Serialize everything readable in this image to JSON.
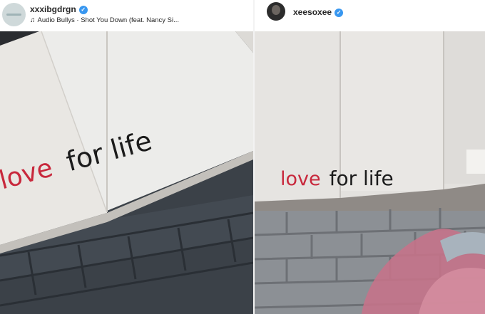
{
  "posts": [
    {
      "username": "xxxibgdrgn",
      "verified": true,
      "audio": "Audio Bullys · Shot You Down (feat. Nancy Si...",
      "photo_text": {
        "love": "love",
        "for_life": "for life"
      }
    },
    {
      "username": "xeesoxee",
      "verified": true,
      "photo_text": {
        "love": "love",
        "for_life": "for life"
      }
    }
  ],
  "icons": {
    "verified": "verified-badge-icon",
    "music_note": "music-note-icon",
    "avatar": "avatar",
    "more": "more-options-icon"
  },
  "colors": {
    "verified_badge": "#3897f0",
    "love_red": "#c8283c",
    "graffiti_black": "#1b1b1b",
    "username_text": "#262626"
  }
}
